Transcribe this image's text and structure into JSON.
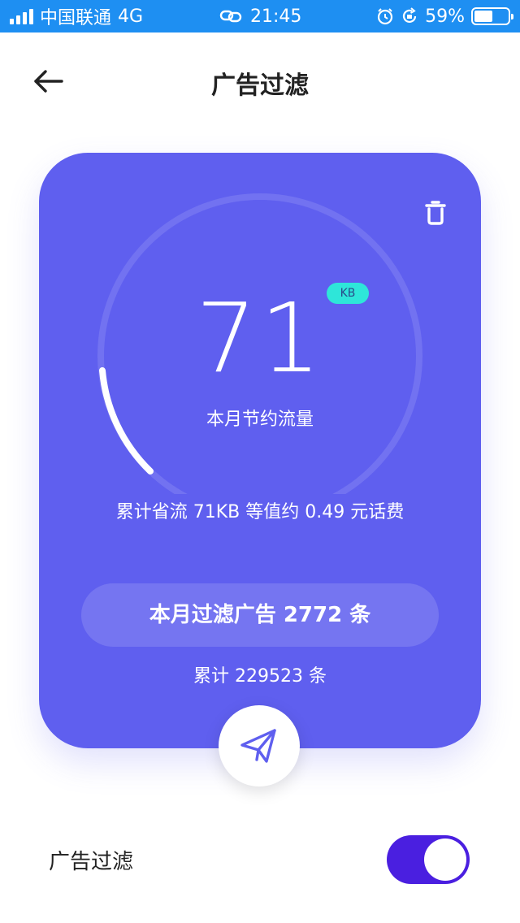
{
  "status_bar": {
    "carrier": "中国联通",
    "network": "4G",
    "time": "21:45",
    "battery": "59%"
  },
  "header": {
    "title": "广告过滤",
    "back_icon": "arrow-left-icon"
  },
  "card": {
    "background_color": "#5f5fef",
    "trash_icon": "trash-icon",
    "saved_value": "71",
    "saved_unit": "KB",
    "caption": "本月节约流量",
    "total_saved_text": "累计省流 71KB 等值约 0.49 元话费",
    "monthly_filtered_text": "本月过滤广告 2772 条",
    "total_filtered_text": "累计 229523 条"
  },
  "fab": {
    "icon": "paper-plane-icon"
  },
  "settings": {
    "ad_filter_label": "广告过滤",
    "ad_filter_enabled": true,
    "toggle_color": "#4a1fe0"
  }
}
